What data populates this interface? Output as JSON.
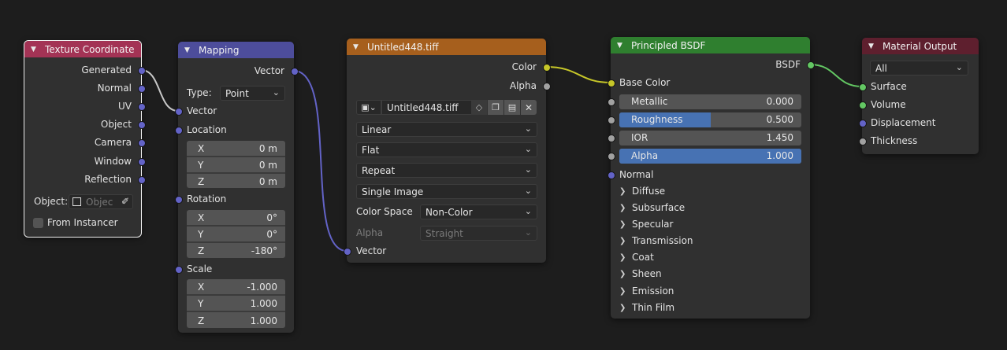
{
  "colors": {
    "background": "#1d1d1d",
    "node_body": "#303030",
    "input_header": "#a33355",
    "vector_header": "#4d4d9b",
    "texture_header": "#a65f1d",
    "shader_header": "#2f7f2f",
    "output_header": "#5e1f2e",
    "socket_vector": "#6363c7",
    "socket_color": "#c7c729",
    "socket_float": "#a1a1a1",
    "socket_shader": "#63c763",
    "slider_fill": "#4772b3"
  },
  "texture_coordinate": {
    "title": "Texture Coordinate",
    "outputs": [
      "Generated",
      "Normal",
      "UV",
      "Object",
      "Camera",
      "Window",
      "Reflection"
    ],
    "object_label": "Object:",
    "object_placeholder": "Objec",
    "from_instancer": "From Instancer"
  },
  "mapping": {
    "title": "Mapping",
    "output": "Vector",
    "type_label": "Type:",
    "type_value": "Point",
    "vector_input": "Vector",
    "location_label": "Location",
    "location": [
      {
        "axis": "X",
        "value": "0 m"
      },
      {
        "axis": "Y",
        "value": "0 m"
      },
      {
        "axis": "Z",
        "value": "0 m"
      }
    ],
    "rotation_label": "Rotation",
    "rotation": [
      {
        "axis": "X",
        "value": "0°"
      },
      {
        "axis": "Y",
        "value": "0°"
      },
      {
        "axis": "Z",
        "value": "-180°"
      }
    ],
    "scale_label": "Scale",
    "scale": [
      {
        "axis": "X",
        "value": "-1.000"
      },
      {
        "axis": "Y",
        "value": "1.000"
      },
      {
        "axis": "Z",
        "value": "1.000"
      }
    ]
  },
  "image_texture": {
    "title": "Untitled448.tiff",
    "out_color": "Color",
    "out_alpha": "Alpha",
    "image_name": "Untitled448.tiff",
    "interpolation": "Linear",
    "projection": "Flat",
    "extension": "Repeat",
    "source": "Single Image",
    "color_space_label": "Color Space",
    "color_space_value": "Non-Color",
    "alpha_label": "Alpha",
    "alpha_value": "Straight",
    "vector_input": "Vector"
  },
  "principled": {
    "title": "Principled BSDF",
    "output": "BSDF",
    "base_color": "Base Color",
    "metallic_label": "Metallic",
    "metallic_value": "0.000",
    "metallic_fraction": 0,
    "roughness_label": "Roughness",
    "roughness_value": "0.500",
    "roughness_fraction": 0.5,
    "ior_label": "IOR",
    "ior_value": "1.450",
    "ior_fraction": 0,
    "alpha_label": "Alpha",
    "alpha_value": "1.000",
    "alpha_fraction": 1,
    "normal": "Normal",
    "panels": [
      "Diffuse",
      "Subsurface",
      "Specular",
      "Transmission",
      "Coat",
      "Sheen",
      "Emission",
      "Thin Film"
    ]
  },
  "material_output": {
    "title": "Material Output",
    "target": "All",
    "inputs": [
      "Surface",
      "Volume",
      "Displacement",
      "Thickness"
    ]
  }
}
